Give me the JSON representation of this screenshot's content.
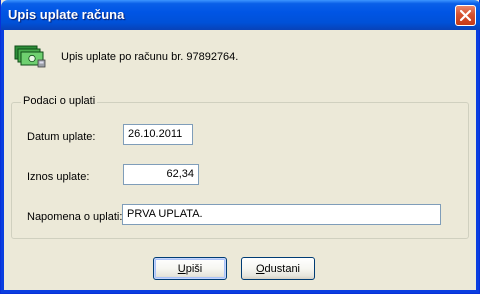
{
  "window": {
    "title": "Upis uplate računa"
  },
  "header": {
    "icon": "money-payment-icon",
    "message": "Upis uplate po računu br. 97892764."
  },
  "group": {
    "legend": "Podaci o uplati",
    "fields": {
      "date": {
        "label": "Datum uplate:",
        "value": "26.10.2011"
      },
      "amount": {
        "label": "Iznos uplate:",
        "value": "62,34"
      },
      "note": {
        "label": "Napomena o uplati:",
        "value": "PRVA UPLATA."
      }
    }
  },
  "buttons": {
    "ok": {
      "accel": "U",
      "rest": "piši"
    },
    "cancel": {
      "accel": "O",
      "rest": "dustani"
    }
  },
  "colors": {
    "titlebar": "#0055e5",
    "close": "#d6522f",
    "face": "#ece9d8"
  }
}
